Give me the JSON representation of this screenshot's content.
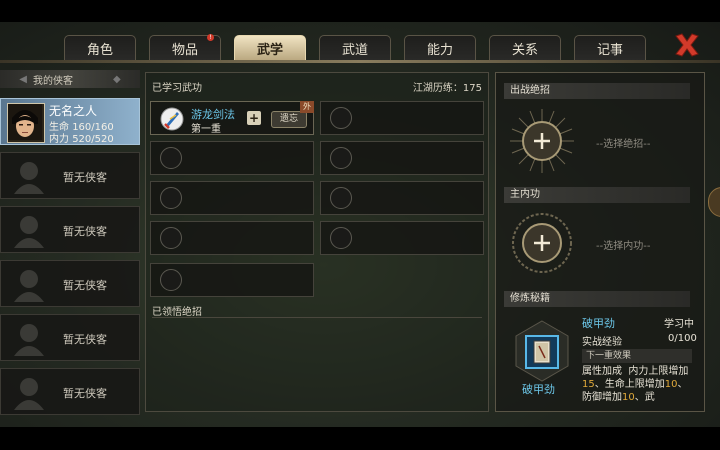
{
  "tabs": [
    {
      "label": "角色",
      "active": false,
      "notify": false
    },
    {
      "label": "物品",
      "active": false,
      "notify": true
    },
    {
      "label": "武学",
      "active": true,
      "notify": false
    },
    {
      "label": "武道",
      "active": false,
      "notify": false
    },
    {
      "label": "能力",
      "active": false,
      "notify": false
    },
    {
      "label": "关系",
      "active": false,
      "notify": false
    },
    {
      "label": "记事",
      "active": false,
      "notify": false
    }
  ],
  "notify_badge": "!",
  "left": {
    "header": "我的侠客",
    "hero": {
      "name": "无名之人",
      "hp_label": "生命",
      "hp_value": "160/160",
      "mp_label": "内力",
      "mp_value": "520/520"
    },
    "empty_label": "暂无侠客"
  },
  "middle": {
    "title": "已学习武功",
    "exp_text": "江湖历练：175",
    "learned_skill": {
      "name": "游龙剑法",
      "level": "第一重",
      "forget_label": "遗忘",
      "tag": "外"
    },
    "realized_title": "已领悟绝招"
  },
  "right": {
    "section1": "出战绝招",
    "hint1": "--选择绝招--",
    "section2": "主内功",
    "hint2": "--选择内功--",
    "section3": "修炼秘籍",
    "book_name": "破甲劲",
    "book_label": "破甲劲",
    "status": "学习中",
    "exp_label": "实战经验",
    "exp_value": "0/100",
    "next_effect": "下一重效果",
    "desc_prefix": "属性加成",
    "desc_a": "内力上限增加",
    "desc_b": "、生命上限增加",
    "desc_c": "、防御增加",
    "desc_d": "、武",
    "v1": "15",
    "v2": "10",
    "v3": "10"
  },
  "colors": {
    "accent_blue": "#6cc6e8",
    "highlight_orange": "#e0a93a",
    "active_tab": "#e8d8b0",
    "close_red": "#d23a2a"
  }
}
